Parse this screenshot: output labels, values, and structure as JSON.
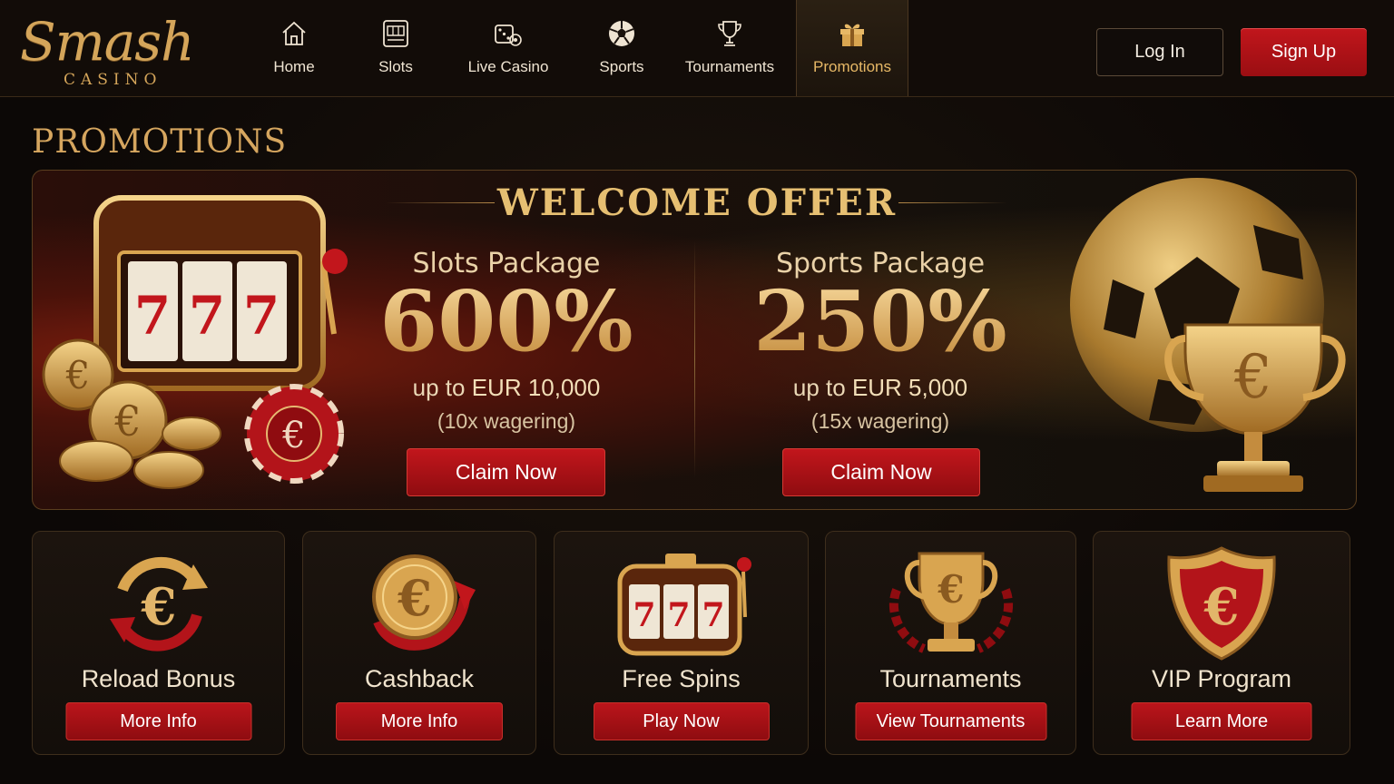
{
  "brand": {
    "name": "Smash",
    "subtitle": "CASINO"
  },
  "nav": [
    {
      "label": "Home",
      "icon": "home-icon"
    },
    {
      "label": "Slots",
      "icon": "slot-machine-icon"
    },
    {
      "label": "Live Casino",
      "icon": "dice-icon"
    },
    {
      "label": "Sports",
      "icon": "soccer-ball-icon"
    },
    {
      "label": "Tournaments",
      "icon": "trophy-icon"
    },
    {
      "label": "Promotions",
      "icon": "gift-icon",
      "active": true
    }
  ],
  "auth": {
    "login_label": "Log In",
    "signup_label": "Sign Up"
  },
  "page_title": "PROMOTIONS",
  "hero": {
    "heading": "WELCOME OFFER",
    "packages": [
      {
        "name": "Slots  Package",
        "percent": "600%",
        "upto_prefix": "up to",
        "amount": "EUR 10,000",
        "wagering": "(10x wagering)",
        "cta": "Claim Now"
      },
      {
        "name": "Sports Package",
        "percent": "250%",
        "upto_prefix": "up to",
        "amount": "EUR 5,000",
        "wagering": "(15x wagering)",
        "cta": "Claim Now"
      }
    ]
  },
  "promos": [
    {
      "title": "Reload Bonus",
      "cta": "More Info",
      "icon": "euro-reload-icon"
    },
    {
      "title": "Cashback",
      "cta": "More Info",
      "icon": "euro-cashback-icon"
    },
    {
      "title": "Free Spins",
      "cta": "Play Now",
      "icon": "slot-machine-777-icon"
    },
    {
      "title": "Tournaments",
      "cta": "View Tournaments",
      "icon": "trophy-laurel-icon"
    },
    {
      "title": "VIP Program",
      "cta": "Learn More",
      "icon": "vip-shield-icon"
    }
  ],
  "colors": {
    "accent_gold": "#d6a65f",
    "cta_red": "#b3141a",
    "background": "#0e0a07"
  }
}
